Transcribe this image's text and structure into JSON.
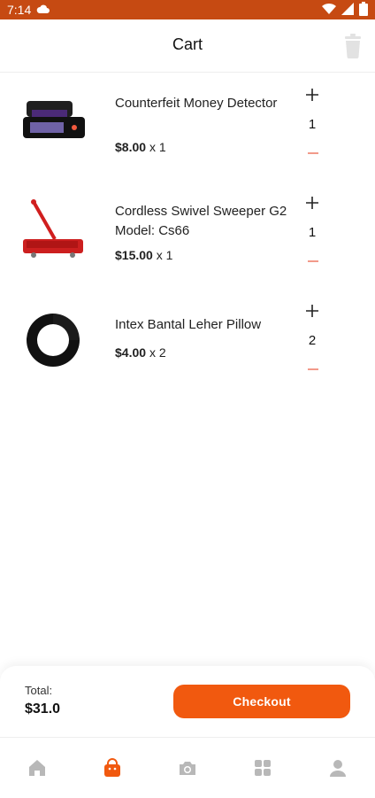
{
  "status_bar": {
    "time": "7:14",
    "icons": [
      "cloud-icon",
      "wifi-icon",
      "signal-icon",
      "battery-icon"
    ]
  },
  "header": {
    "title": "Cart",
    "icons": [
      "trash-icon"
    ]
  },
  "cart": {
    "items": [
      {
        "name": "Counterfeit Money Detector",
        "price": "$8.00",
        "multiplier": "x 1",
        "quantity": "1",
        "image_icon": "money-detector-image"
      },
      {
        "name": "Cordless Swivel Sweeper G2 Model: Cs66",
        "price": "$15.00",
        "multiplier": "x 1",
        "quantity": "1",
        "image_icon": "sweeper-image"
      },
      {
        "name": "Intex Bantal Leher Pillow",
        "price": "$4.00",
        "multiplier": "x 2",
        "quantity": "2",
        "image_icon": "neck-pillow-image"
      }
    ]
  },
  "summary": {
    "total_label": "Total:",
    "total_value": "$31.0",
    "checkout_label": "Checkout"
  },
  "colors": {
    "status_bar": "#c64a12",
    "accent": "#f1590f",
    "minus": "#f29a8a",
    "inactive_icon": "#b8b8b8"
  },
  "nav": {
    "icons": [
      "home-icon",
      "cart-icon",
      "camera-icon",
      "grid-icon",
      "profile-icon"
    ],
    "active": "cart-icon"
  }
}
